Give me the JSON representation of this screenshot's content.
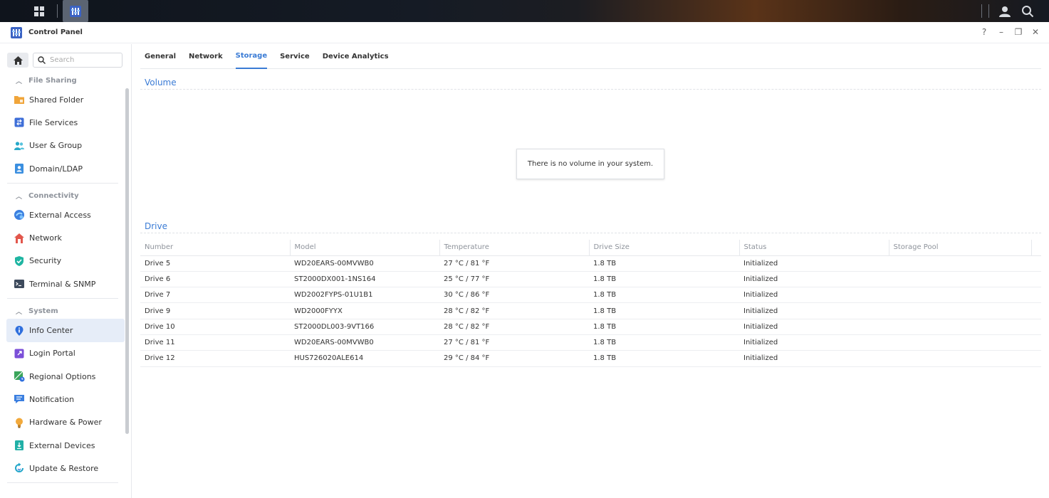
{
  "window": {
    "title": "Control Panel"
  },
  "window_controls": {
    "help": "?",
    "minimize": "–",
    "restore": "❐",
    "close": "✕"
  },
  "sidebar": {
    "search_placeholder": "Search",
    "groups": [
      {
        "label": "File Sharing",
        "items": [
          {
            "label": "Shared Folder",
            "icon": "shared-folder-icon"
          },
          {
            "label": "File Services",
            "icon": "file-services-icon"
          },
          {
            "label": "User & Group",
            "icon": "user-group-icon"
          },
          {
            "label": "Domain/LDAP",
            "icon": "domain-ldap-icon"
          }
        ]
      },
      {
        "label": "Connectivity",
        "items": [
          {
            "label": "External Access",
            "icon": "external-access-icon"
          },
          {
            "label": "Network",
            "icon": "network-icon"
          },
          {
            "label": "Security",
            "icon": "shield-icon"
          },
          {
            "label": "Terminal & SNMP",
            "icon": "terminal-icon"
          }
        ]
      },
      {
        "label": "System",
        "items": [
          {
            "label": "Info Center",
            "icon": "info-icon",
            "active": true
          },
          {
            "label": "Login Portal",
            "icon": "login-portal-icon"
          },
          {
            "label": "Regional Options",
            "icon": "regional-options-icon"
          },
          {
            "label": "Notification",
            "icon": "notification-icon"
          },
          {
            "label": "Hardware & Power",
            "icon": "lightbulb-icon"
          },
          {
            "label": "External Devices",
            "icon": "external-devices-icon"
          },
          {
            "label": "Update & Restore",
            "icon": "update-restore-icon"
          }
        ]
      }
    ]
  },
  "tabs": [
    {
      "label": "General",
      "active": false
    },
    {
      "label": "Network",
      "active": false
    },
    {
      "label": "Storage",
      "active": true
    },
    {
      "label": "Service",
      "active": false
    },
    {
      "label": "Device Analytics",
      "active": false
    }
  ],
  "volume": {
    "title": "Volume",
    "empty_message": "There is no volume in your system."
  },
  "drive": {
    "title": "Drive",
    "columns": [
      "Number",
      "Model",
      "Temperature",
      "Drive Size",
      "Status",
      "Storage Pool"
    ],
    "rows": [
      {
        "number": "Drive 5",
        "model": "WD20EARS-00MVWB0",
        "temperature": "27 °C / 81 °F",
        "size": "1.8 TB",
        "status": "Initialized",
        "pool": ""
      },
      {
        "number": "Drive 6",
        "model": "ST2000DX001-1NS164",
        "temperature": "25 °C / 77 °F",
        "size": "1.8 TB",
        "status": "Initialized",
        "pool": ""
      },
      {
        "number": "Drive 7",
        "model": "WD2002FYPS-01U1B1",
        "temperature": "30 °C / 86 °F",
        "size": "1.8 TB",
        "status": "Initialized",
        "pool": ""
      },
      {
        "number": "Drive 9",
        "model": "WD2000FYYX",
        "temperature": "28 °C / 82 °F",
        "size": "1.8 TB",
        "status": "Initialized",
        "pool": ""
      },
      {
        "number": "Drive 10",
        "model": "ST2000DL003-9VT166",
        "temperature": "28 °C / 82 °F",
        "size": "1.8 TB",
        "status": "Initialized",
        "pool": ""
      },
      {
        "number": "Drive 11",
        "model": "WD20EARS-00MVWB0",
        "temperature": "27 °C / 81 °F",
        "size": "1.8 TB",
        "status": "Initialized",
        "pool": ""
      },
      {
        "number": "Drive 12",
        "model": "HUS726020ALE614",
        "temperature": "29 °C / 84 °F",
        "size": "1.8 TB",
        "status": "Initialized",
        "pool": ""
      }
    ]
  },
  "colors": {
    "accent": "#3a7bd5",
    "status_ok": "#23a42a"
  }
}
